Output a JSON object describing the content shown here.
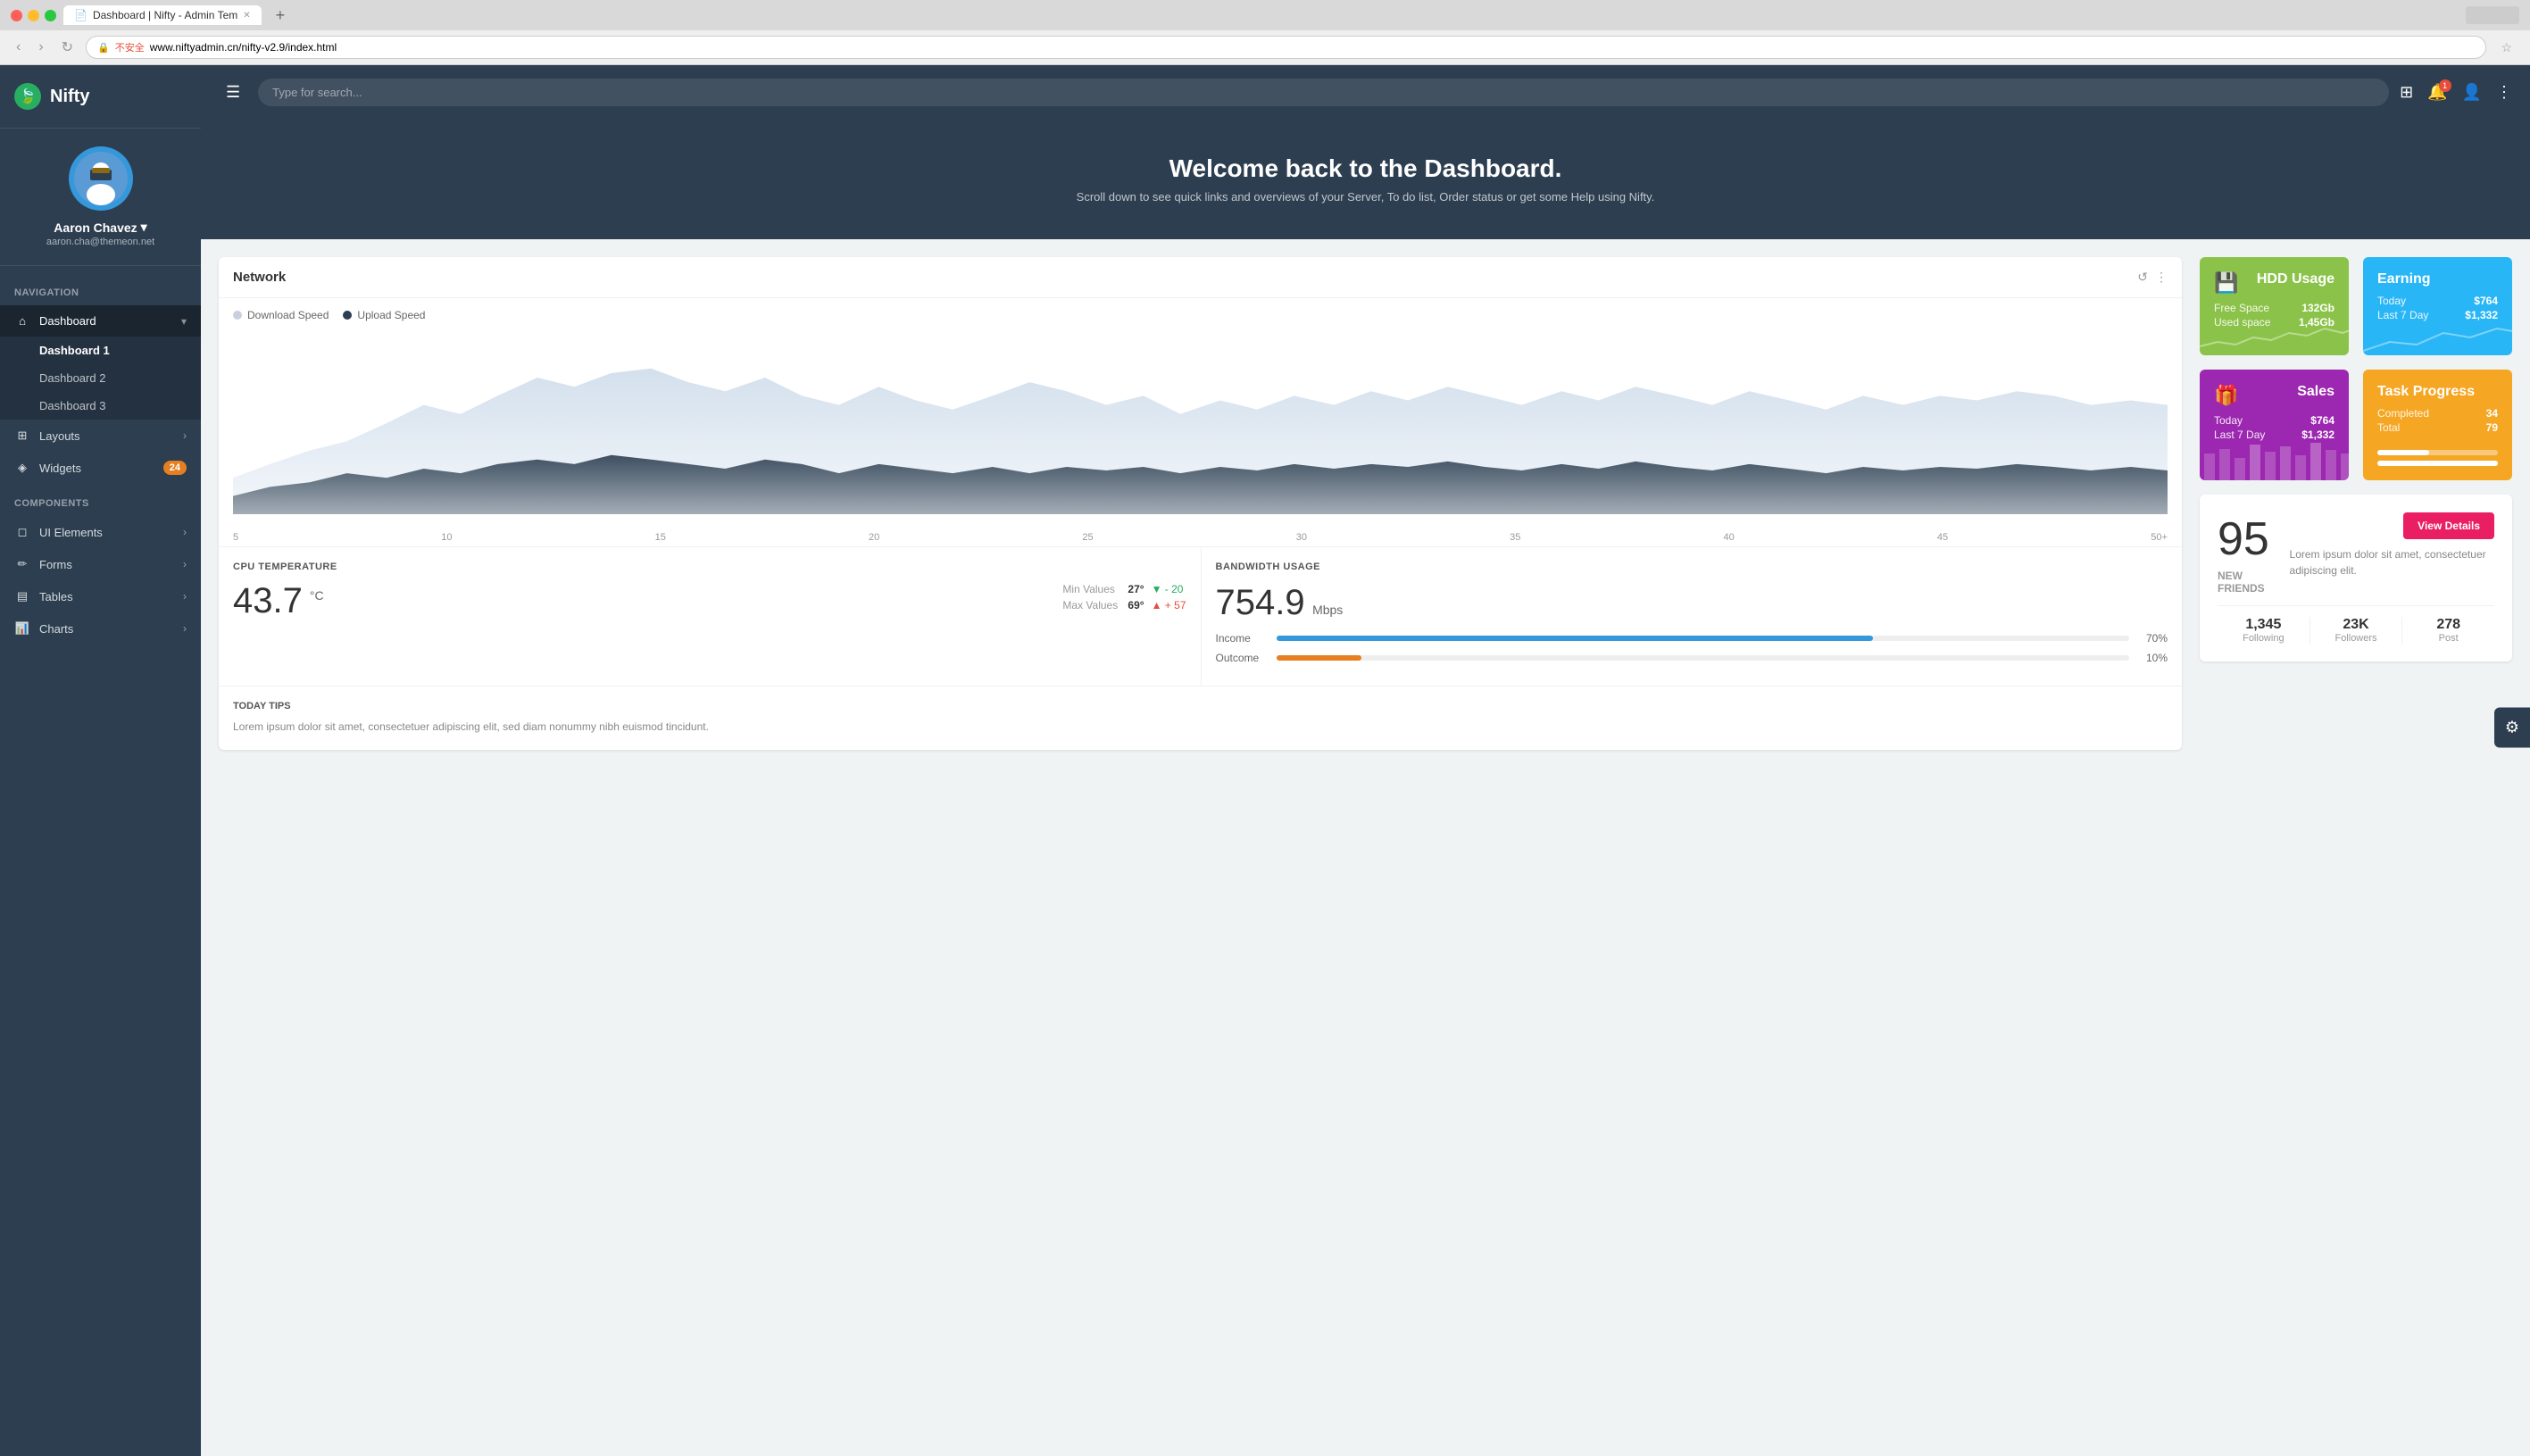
{
  "browser": {
    "tab_title": "Dashboard | Nifty - Admin Tem",
    "url": "www.niftyadmin.cn/nifty-v2.9/index.html",
    "url_prefix": "不安全",
    "new_tab_label": "+"
  },
  "topbar": {
    "brand": "Nifty",
    "search_placeholder": "Type for search...",
    "hamburger_icon": "☰"
  },
  "sidebar": {
    "user": {
      "name": "Aaron Chavez",
      "email": "aaron.cha@themeon.net"
    },
    "nav_section": "NAVIGATION",
    "components_section": "COMPONENTS",
    "items": [
      {
        "label": "Dashboard",
        "icon": "⌂",
        "active": true,
        "has_sub": true
      },
      {
        "label": "Layouts",
        "icon": "⊞",
        "has_arrow": true
      },
      {
        "label": "Widgets",
        "icon": "◈",
        "badge": "24"
      },
      {
        "label": "UI Elements",
        "icon": "◻",
        "has_arrow": true
      },
      {
        "label": "Forms",
        "icon": "✏",
        "has_arrow": true
      },
      {
        "label": "Tables",
        "icon": "▤",
        "has_arrow": true
      },
      {
        "label": "Charts",
        "icon": "📊",
        "has_arrow": true
      }
    ],
    "dashboard_sub": [
      {
        "label": "Dashboard 1",
        "active": true
      },
      {
        "label": "Dashboard 2"
      },
      {
        "label": "Dashboard 3"
      }
    ]
  },
  "hero": {
    "title": "Welcome back to the Dashboard.",
    "subtitle": "Scroll down to see quick links and overviews of your Server, To do list, Order status or get some Help using Nifty."
  },
  "network_card": {
    "title": "Network",
    "legend": {
      "download": "Download Speed",
      "upload": "Upload Speed"
    },
    "x_labels": [
      "5",
      "10",
      "15",
      "20",
      "25",
      "30",
      "35",
      "40",
      "45",
      "50+"
    ]
  },
  "cpu": {
    "section_title": "CPU TEMPERATURE",
    "value": "43.7",
    "unit": "°C",
    "min_label": "Min Values",
    "min_value": "27°",
    "min_delta": "- 20",
    "max_label": "Max Values",
    "max_value": "69°",
    "max_delta": "+ 57"
  },
  "bandwidth": {
    "section_title": "BANDWIDTH USAGE",
    "value": "754.9",
    "unit": "Mbps",
    "income_label": "Income",
    "income_pct": "70%",
    "income_width": "70",
    "outcome_label": "Outcome",
    "outcome_pct": "10%",
    "outcome_width": "10"
  },
  "today_tips": {
    "title": "TODAY TIPS",
    "text": "Lorem ipsum dolor sit amet, consectetuer adipiscing elit, sed diam nonummy nibh euismod tincidunt."
  },
  "hdd_card": {
    "icon": "💾",
    "title": "HDD Usage",
    "free_label": "Free Space",
    "free_value": "132Gb",
    "used_label": "Used space",
    "used_value": "1,45Gb"
  },
  "earning_card": {
    "title": "Earning",
    "today_label": "Today",
    "today_value": "$764",
    "last7_label": "Last 7 Day",
    "last7_value": "$1,332"
  },
  "sales_card": {
    "icon": "🎁",
    "title": "Sales",
    "today_label": "Today",
    "today_value": "$764",
    "last7_label": "Last 7 Day",
    "last7_value": "$1,332"
  },
  "task_card": {
    "title": "Task Progress",
    "completed_label": "Completed",
    "completed_value": "34",
    "total_label": "Total",
    "total_value": "79",
    "completed_pct": "43",
    "total_pct": "100"
  },
  "social": {
    "number": "95",
    "label": "NEW FRIENDS",
    "desc": "Lorem ipsum dolor sit amet, consectetuer adipiscing elit.",
    "view_details": "View Details",
    "stats": [
      {
        "value": "1,345",
        "label": "Following"
      },
      {
        "value": "23K",
        "label": "Followers"
      },
      {
        "value": "278",
        "label": "Post"
      }
    ]
  }
}
